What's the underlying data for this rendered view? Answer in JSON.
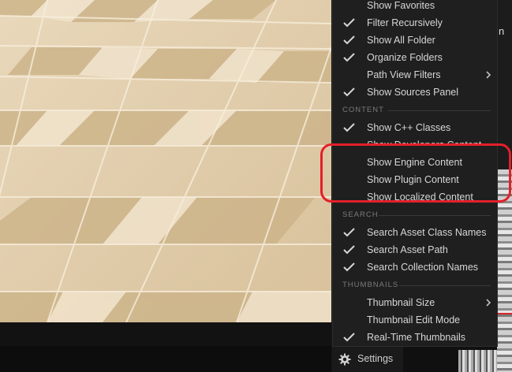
{
  "menu": {
    "items": [
      {
        "label": "Show Favorites",
        "checked": false
      },
      {
        "label": "Filter Recursively",
        "checked": true
      },
      {
        "label": "Show All Folder",
        "checked": true
      },
      {
        "label": "Organize Folders",
        "checked": true
      },
      {
        "label": "Path View Filters",
        "checked": false,
        "submenu": true
      },
      {
        "label": "Show Sources Panel",
        "checked": true
      }
    ],
    "content_section": "CONTENT",
    "content_items": [
      {
        "label": "Show C++ Classes",
        "checked": true
      },
      {
        "label": "Show Developers Content",
        "checked": false
      },
      {
        "label": "Show Engine Content",
        "checked": false
      },
      {
        "label": "Show Plugin Content",
        "checked": false
      },
      {
        "label": "Show Localized Content",
        "checked": false
      }
    ],
    "search_section": "SEARCH",
    "search_items": [
      {
        "label": "Search Asset Class Names",
        "checked": true
      },
      {
        "label": "Search Asset Path",
        "checked": true
      },
      {
        "label": "Search Collection Names",
        "checked": true
      }
    ],
    "thumbnails_section": "THUMBNAILS",
    "thumbnail_items": [
      {
        "label": "Thumbnail Size",
        "checked": false,
        "submenu": true
      },
      {
        "label": "Thumbnail Edit Mode",
        "checked": false
      },
      {
        "label": "Real-Time Thumbnails",
        "checked": true
      }
    ]
  },
  "settings": {
    "label": "Settings",
    "icon": "gear-icon"
  },
  "right_panel": {
    "letter": "n"
  },
  "colors": {
    "highlight": "#e3202a",
    "menu_bg": "#1f1f1f",
    "text": "#d6d6d6"
  }
}
